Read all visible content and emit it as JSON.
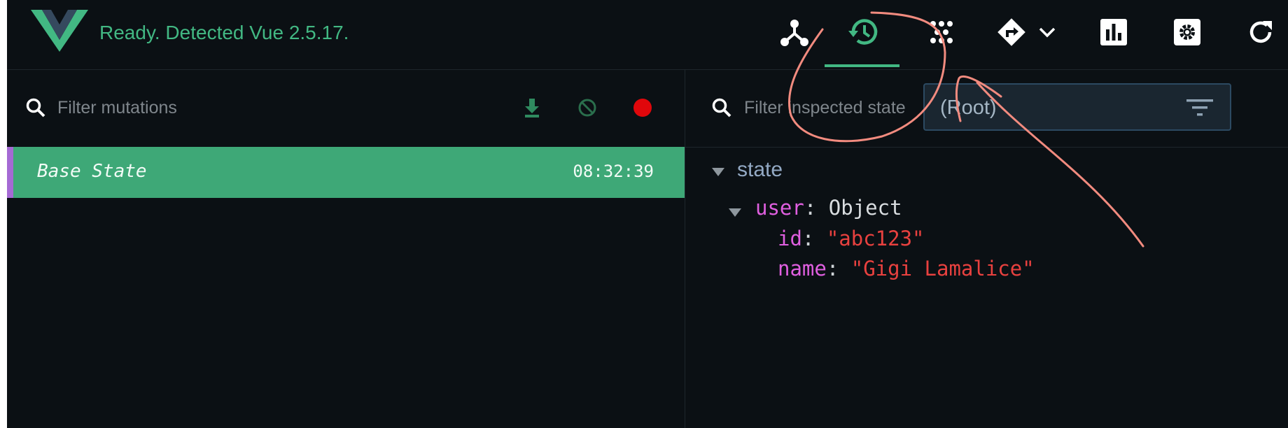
{
  "header": {
    "status": "Ready. Detected Vue 2.5.17."
  },
  "toolbar": {
    "buttons": [
      {
        "name": "components",
        "icon": "components-tree-icon"
      },
      {
        "name": "vuex-history",
        "icon": "history-icon",
        "active": true
      },
      {
        "name": "events",
        "icon": "events-icon"
      },
      {
        "name": "routing",
        "icon": "routing-icon"
      },
      {
        "name": "performance",
        "icon": "bar-chart-icon"
      },
      {
        "name": "settings",
        "icon": "gear-icon"
      },
      {
        "name": "refresh",
        "icon": "refresh-icon"
      }
    ],
    "accent_color": "#42b883"
  },
  "mutations": {
    "filter_placeholder": "Filter mutations",
    "actions": [
      "download-icon",
      "clear-icon",
      "record-icon"
    ],
    "items": [
      {
        "name": "Base State",
        "time": "08:32:39"
      }
    ]
  },
  "inspector": {
    "filter_placeholder": "Filter inspected state",
    "module_select": "(Root)",
    "state_label": "state",
    "user": {
      "key": "user",
      "type": "Object",
      "fields": [
        {
          "key": "id",
          "value": "\"abc123\""
        },
        {
          "key": "name",
          "value": "\"Gigi Lamalice\""
        }
      ]
    }
  },
  "colors": {
    "background": "#0b1014",
    "selected_row": "#3ea877",
    "annotation": "#f28b7f"
  }
}
